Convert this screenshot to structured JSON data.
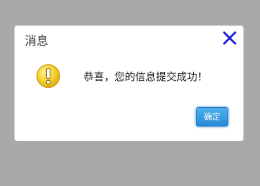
{
  "dialog": {
    "title": "消息",
    "message": "恭喜，您的信息提交成功！",
    "ok_label": "确定",
    "close_icon": "close-icon",
    "status_icon": "warning-exclamation-icon"
  },
  "colors": {
    "overlay": "#a9a9a9",
    "close_icon": "#1a1adc",
    "icon_fill": "#f4d02a",
    "button": "#2f8fdc"
  }
}
